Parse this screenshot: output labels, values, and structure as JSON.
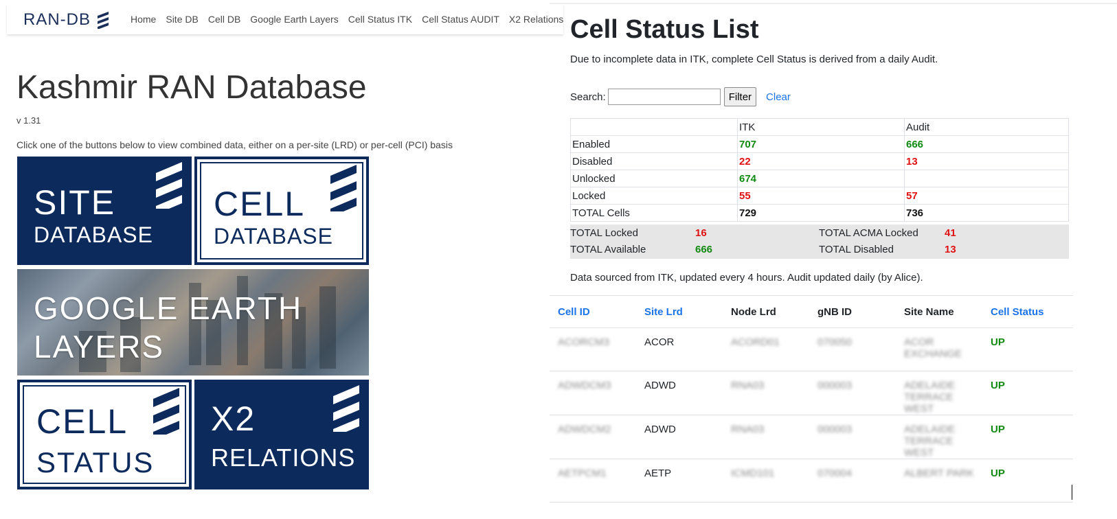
{
  "nav": {
    "brand": "RAN-DB",
    "links": [
      "Home",
      "Site DB",
      "Cell DB",
      "Google Earth Layers",
      "Cell Status ITK",
      "Cell Status AUDIT",
      "X2 Relations"
    ]
  },
  "home": {
    "title": "Kashmir RAN Database",
    "version": "v 1.31",
    "intro": "Click one of the buttons below to view combined data, either on a per-site (LRD) or per-cell (PCI) basis",
    "tiles": {
      "site": {
        "big": "SITE",
        "small": "DATABASE"
      },
      "cell": {
        "big": "CELL",
        "small": "DATABASE"
      },
      "earth": {
        "line1": "GOOGLE EARTH",
        "line2": "LAYERS"
      },
      "status": {
        "big": "CELL",
        "small": "STATUS"
      },
      "x2": {
        "big": "X2",
        "small": "RELATIONS"
      }
    }
  },
  "status_page": {
    "title": "Cell Status List",
    "subtitle": "Due to incomplete data in ITK, complete Cell Status is derived from a daily Audit.",
    "search_label": "Search:",
    "search_value": "",
    "filter_label": "Filter",
    "clear_label": "Clear",
    "stats": {
      "headers": [
        "",
        "ITK",
        "Audit"
      ],
      "rows": [
        {
          "label": "Enabled",
          "itk": "707",
          "audit": "666"
        },
        {
          "label": "Disabled",
          "itk": "22",
          "audit": "13"
        },
        {
          "label": "Unlocked",
          "itk": "674",
          "audit": ""
        },
        {
          "label": "Locked",
          "itk": "55",
          "audit": "57"
        },
        {
          "label": "TOTAL Cells",
          "itk": "729",
          "audit": "736"
        }
      ]
    },
    "totals": {
      "locked_label": "TOTAL Locked",
      "locked_value": "16",
      "acma_label": "TOTAL ACMA Locked",
      "acma_value": "41",
      "available_label": "TOTAL Available",
      "available_value": "666",
      "disabled_label": "TOTAL Disabled",
      "disabled_value": "13"
    },
    "sourced_note": "Data sourced from ITK, updated every 4 hours. Audit updated daily (by Alice).",
    "table": {
      "headers": [
        "Cell ID",
        "Site Lrd",
        "Node Lrd",
        "gNB ID",
        "Site Name",
        "Cell Status"
      ],
      "rows": [
        {
          "cell_id": "ACORCM3",
          "site_lrd": "ACOR",
          "node_lrd": "ACORD01",
          "gnb_id": "070050",
          "site_name": "ACOR EXCHANGE",
          "status": "UP"
        },
        {
          "cell_id": "ADWDCM3",
          "site_lrd": "ADWD",
          "node_lrd": "RNA03",
          "gnb_id": "000003",
          "site_name": "ADELAIDE TERRACE WEST",
          "status": "UP"
        },
        {
          "cell_id": "ADWDCM2",
          "site_lrd": "ADWD",
          "node_lrd": "RNA03",
          "gnb_id": "000003",
          "site_name": "ADELAIDE TERRACE WEST",
          "status": "UP"
        },
        {
          "cell_id": "AETPCM1",
          "site_lrd": "AETP",
          "node_lrd": "ICMD101",
          "gnb_id": "070004",
          "site_name": "ALBERT PARK",
          "status": "UP"
        }
      ]
    }
  }
}
